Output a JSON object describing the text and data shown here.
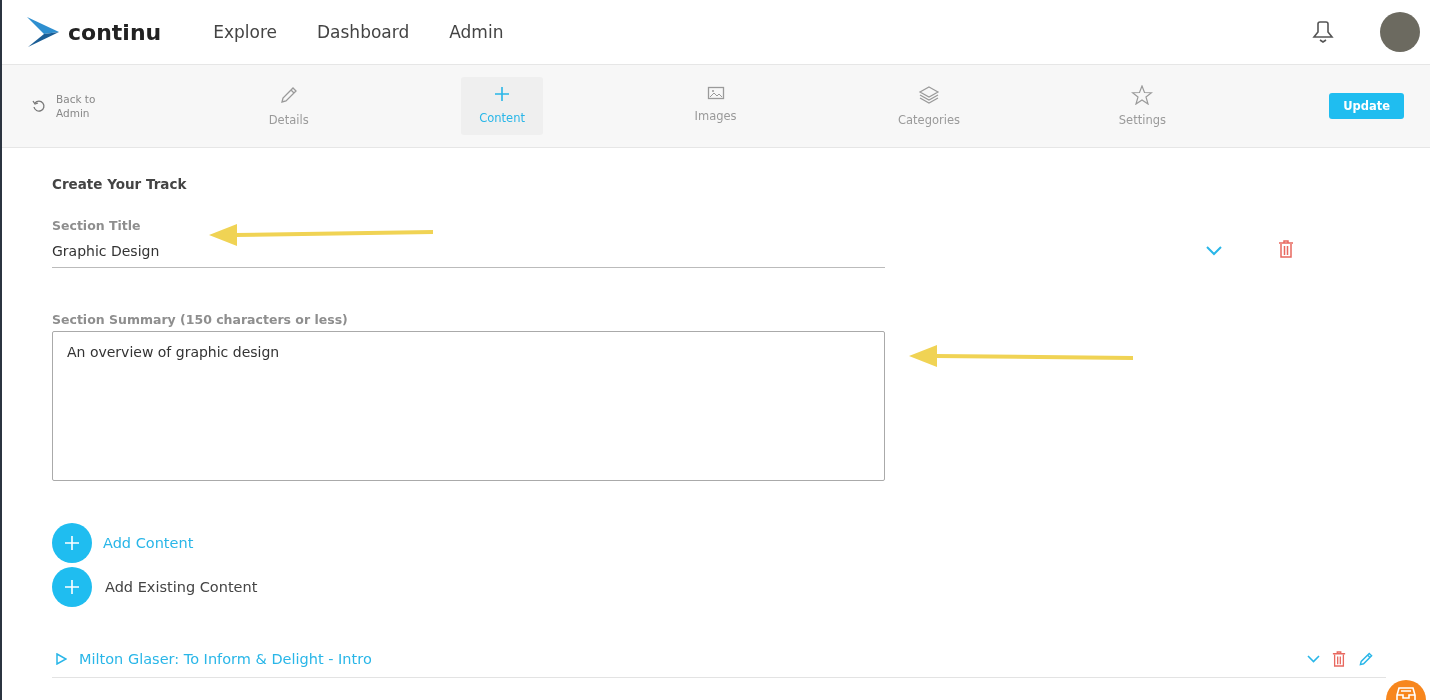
{
  "brand": "continu",
  "nav": [
    {
      "label": "Explore"
    },
    {
      "label": "Dashboard"
    },
    {
      "label": "Admin"
    }
  ],
  "back": {
    "label": "Back to Admin"
  },
  "tabs": [
    {
      "label": "Details",
      "selected": false
    },
    {
      "label": "Content",
      "selected": true
    },
    {
      "label": "Images",
      "selected": false
    },
    {
      "label": "Categories",
      "selected": false
    },
    {
      "label": "Settings",
      "selected": false
    }
  ],
  "update_button": "Update",
  "heading": "Create Your Track",
  "section_title": {
    "label": "Section Title",
    "value": "Graphic Design"
  },
  "section_summary": {
    "label": "Section Summary (150 characters or less)",
    "value": "An overview of graphic design"
  },
  "add_actions": [
    {
      "label": "Add Content",
      "kind": "link"
    },
    {
      "label": "Add Existing Content",
      "kind": "plain"
    }
  ],
  "content_items": [
    {
      "title": "Milton Glaser: To Inform & Delight - Intro"
    }
  ]
}
